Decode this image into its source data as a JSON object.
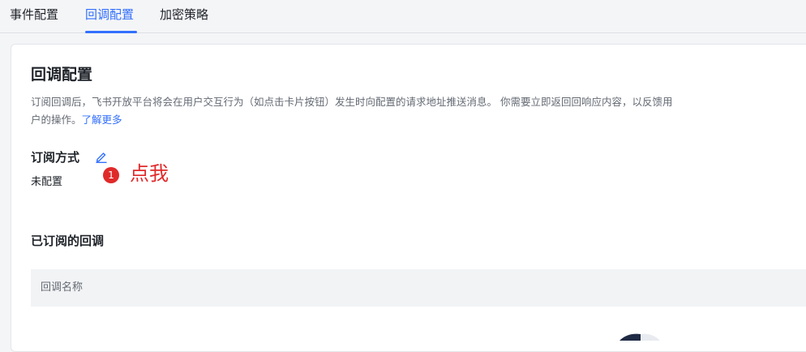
{
  "tabs": [
    {
      "label": "事件配置",
      "active": false
    },
    {
      "label": "回调配置",
      "active": true
    },
    {
      "label": "加密策略",
      "active": false
    }
  ],
  "page": {
    "title": "回调配置",
    "description": "订阅回调后，飞书开放平台将会在用户交互行为（如点击卡片按钮）发生时向配置的请求地址推送消息。 你需要立即返回回响应内容，以反馈用户的操作。",
    "learn_more": "了解更多"
  },
  "subscription": {
    "label": "订阅方式",
    "value": "未配置",
    "edit_icon": "pencil-icon"
  },
  "annotation": {
    "step": "1",
    "text": "点我",
    "color": "#e02a2a"
  },
  "subscribed": {
    "title": "已订阅的回调",
    "columns": [
      "回调名称"
    ]
  },
  "colors": {
    "accent": "#3370ff",
    "text": "#1f2329",
    "muted": "#646a73",
    "table_header_bg": "#f2f3f5"
  }
}
